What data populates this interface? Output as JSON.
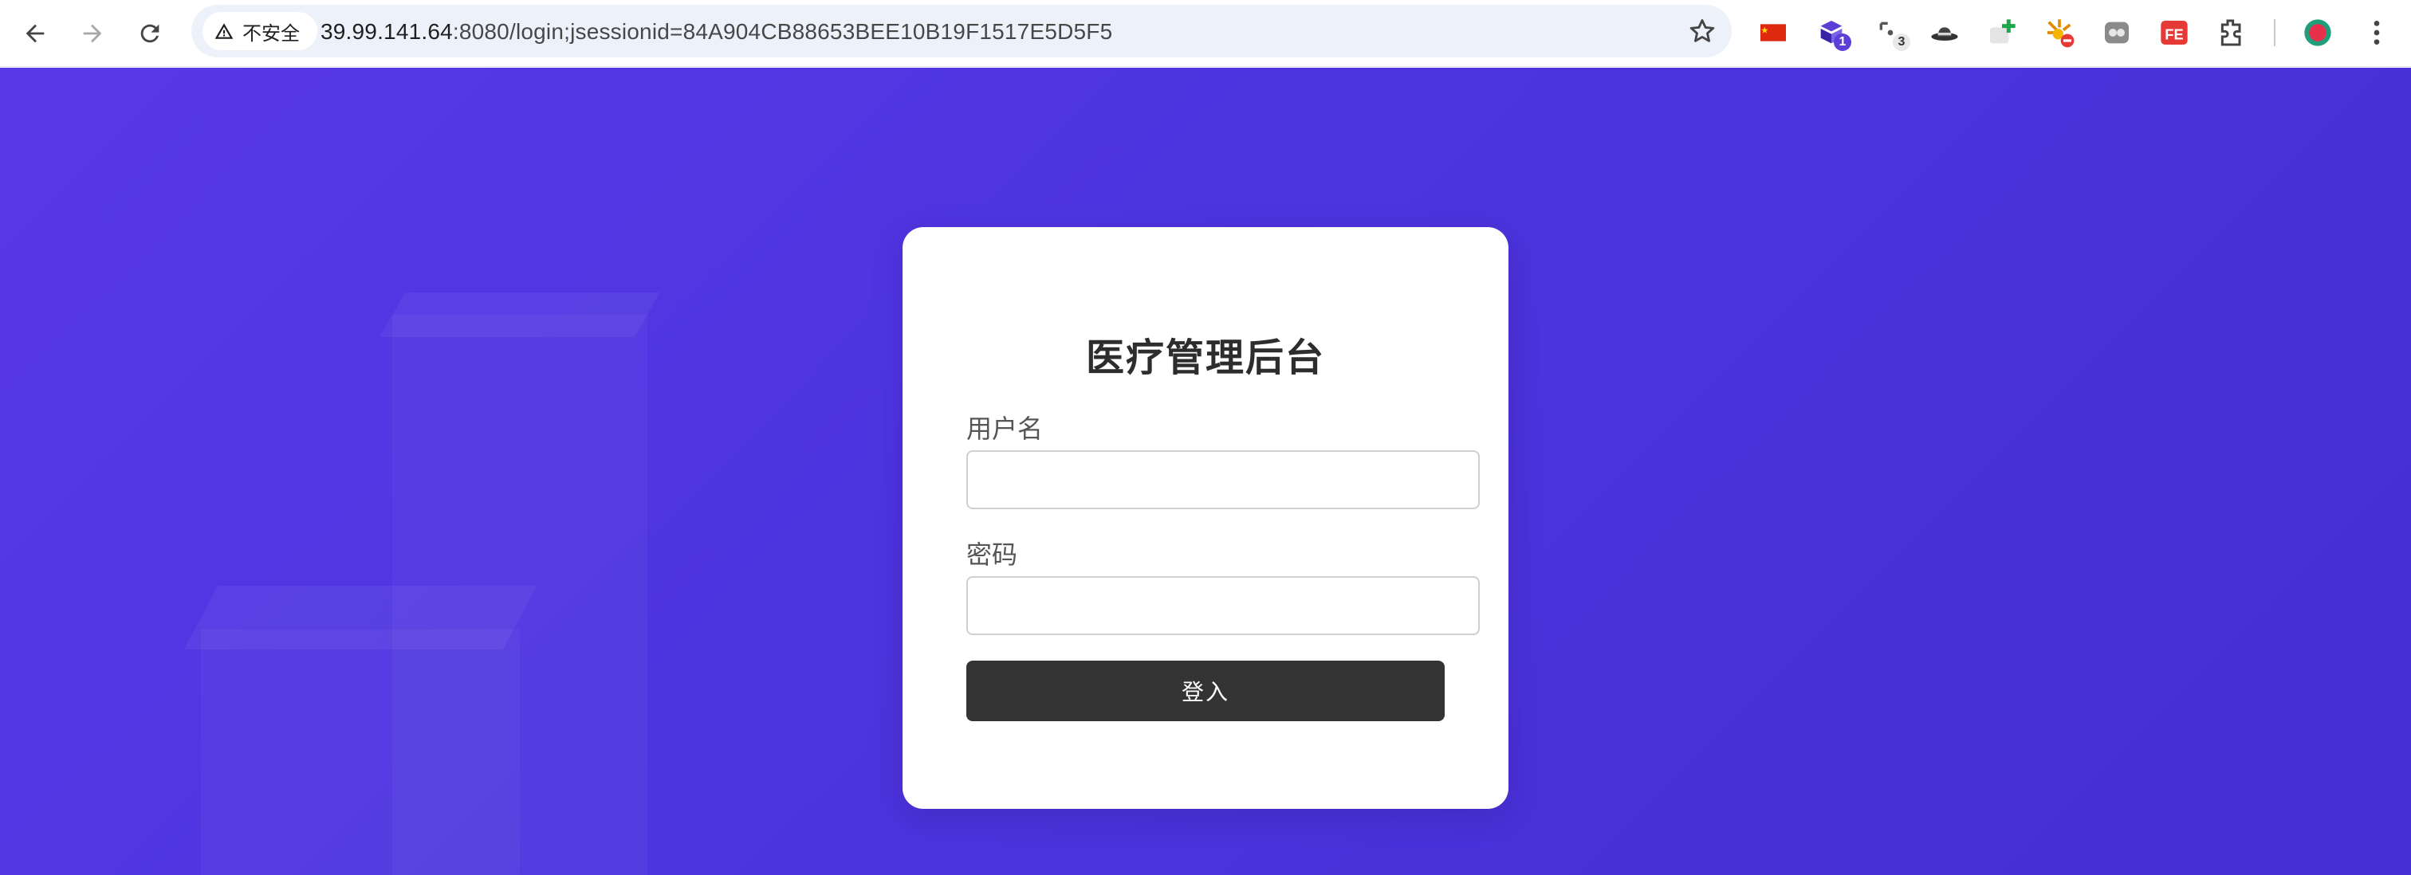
{
  "browser": {
    "security_label": "不安全",
    "url_host": "39.99.141.64",
    "url_rest": ":8080/login;jsessionid=84A904CB88653BEE10B19F1517E5D5F5",
    "extensions": [
      {
        "name": "china-flag-extension",
        "badge": ""
      },
      {
        "name": "purple-ext",
        "badge": "1"
      },
      {
        "name": "tabs-ext",
        "badge": "3"
      },
      {
        "name": "hat-ext",
        "badge": ""
      },
      {
        "name": "add-ext",
        "badge": ""
      },
      {
        "name": "spark-ext",
        "badge": ""
      },
      {
        "name": "theme-ext",
        "badge": ""
      },
      {
        "name": "fe-ext",
        "badge": ""
      }
    ]
  },
  "login": {
    "title": "医疗管理后台",
    "username_label": "用户名",
    "username_value": "",
    "password_label": "密码",
    "password_value": "",
    "submit_label": "登入"
  },
  "colors": {
    "background_start": "#5738e8",
    "background_end": "#462ed2",
    "button": "#343434",
    "card": "#ffffff"
  }
}
